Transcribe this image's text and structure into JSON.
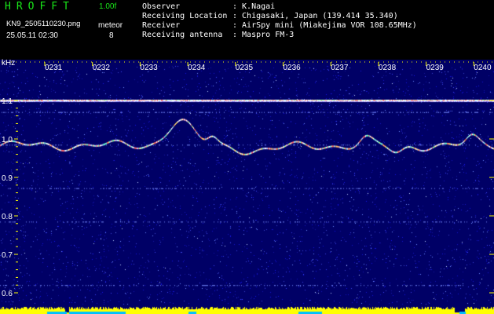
{
  "header": {
    "brand": "HROFFT",
    "version": "1.00f",
    "filename": "KN9_2505110230.png",
    "mode_label": "meteor",
    "datetime": "25.05.11 02:30",
    "mode_value": "8"
  },
  "station_info": [
    {
      "label": "Observer",
      "value": ": K.Nagai"
    },
    {
      "label": "Receiving Location",
      "value": ": Chigasaki, Japan (139.414 35.340)"
    },
    {
      "label": "Receiver",
      "value": ": AirSpy mini (Miakejima VOR 108.65MHz)"
    },
    {
      "label": "Receiving antenna",
      "value": ": Maspro FM-3"
    }
  ],
  "spectrogram": {
    "unit": "kHz",
    "time_labels": [
      "0231",
      "0232",
      "0233",
      "0234",
      "0235",
      "0236",
      "0237",
      "0238",
      "0239",
      "0240"
    ],
    "freq_labels": [
      "1.1",
      "1.0",
      "0.9",
      "0.8",
      "0.7",
      "0.6"
    ],
    "colors": {
      "background": "#000066",
      "text": "#ffffff",
      "marker": "#ffff00",
      "signal_bar": "#ffff00"
    }
  }
}
